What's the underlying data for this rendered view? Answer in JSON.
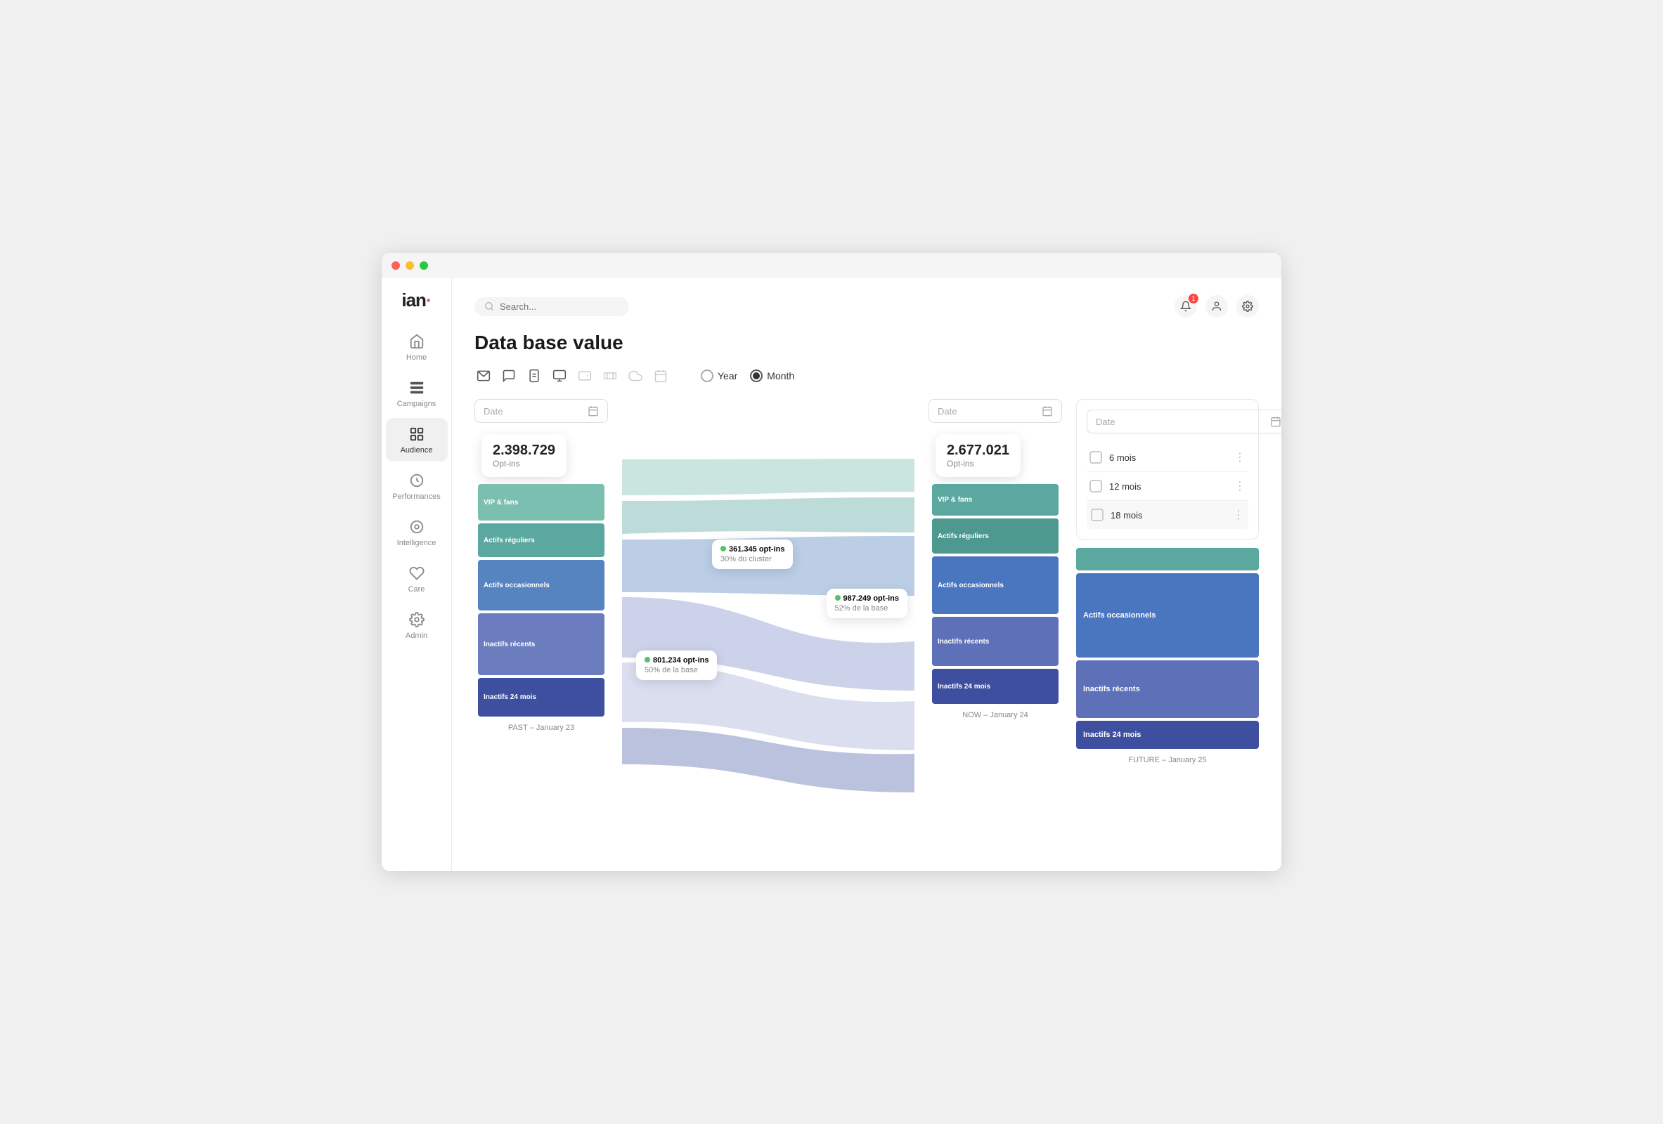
{
  "app": {
    "logo": "ian",
    "logo_dot": "·"
  },
  "topbar": {
    "search_placeholder": "Search...",
    "notification_count": "1"
  },
  "nav": {
    "items": [
      {
        "id": "home",
        "label": "Home",
        "active": false
      },
      {
        "id": "campaigns",
        "label": "Campaigns",
        "active": false
      },
      {
        "id": "audience",
        "label": "Audience",
        "active": true
      },
      {
        "id": "performances",
        "label": "Performances",
        "active": false
      },
      {
        "id": "intelligence",
        "label": "Intelligence",
        "active": false
      },
      {
        "id": "care",
        "label": "Care",
        "active": false
      },
      {
        "id": "admin",
        "label": "Admin",
        "active": false
      }
    ]
  },
  "page": {
    "title": "Data base value"
  },
  "toolbar": {
    "period_options": [
      {
        "id": "year",
        "label": "Year",
        "selected": false
      },
      {
        "id": "month",
        "label": "Month",
        "selected": true
      }
    ]
  },
  "columns": {
    "past": {
      "date_placeholder": "Date",
      "label": "PAST – January 23",
      "optins_num": "2.398.729",
      "optins_label": "Opt-ins",
      "segments": [
        {
          "label": "VIP & fans",
          "color": "#7bbfb0",
          "height": 60
        },
        {
          "label": "Actifs réguliers",
          "color": "#5ba8a0",
          "height": 55
        },
        {
          "label": "Actifs occasionnels",
          "color": "#5584c0",
          "height": 80
        },
        {
          "label": "Inactifs récents",
          "color": "#6b7dbf",
          "height": 100
        },
        {
          "label": "Inactifs 24 mois",
          "color": "#3d4f9e",
          "height": 60
        }
      ]
    },
    "now": {
      "date_placeholder": "Date",
      "label": "NOW – January 24",
      "optins_num": "2.677.021",
      "optins_label": "Opt-ins",
      "segments": [
        {
          "label": "VIP & fans",
          "color": "#5ba8a0",
          "height": 50
        },
        {
          "label": "Actifs réguliers",
          "color": "#4d9990",
          "height": 55
        },
        {
          "label": "Actifs occasionnels",
          "color": "#4a76c0",
          "height": 90
        },
        {
          "label": "Inactifs récents",
          "color": "#5e70b8",
          "height": 75
        },
        {
          "label": "Inactifs 24 mois",
          "color": "#3d4f9e",
          "height": 55
        }
      ]
    },
    "future": {
      "date_placeholder": "Date",
      "label": "FUTURE – January 25",
      "segments": [
        {
          "label": "Actifs occasionnels",
          "color": "#4a76c0",
          "height": 130
        },
        {
          "label": "Inactifs récents",
          "color": "#5e70b8",
          "height": 90
        },
        {
          "label": "Inactifs 24 mois",
          "color": "#3d4f9e",
          "height": 45
        }
      ],
      "top_seg": {
        "label": "",
        "color": "#5ba8a0",
        "height": 35
      },
      "checkbox_options": [
        {
          "id": "6mois",
          "label": "6 mois",
          "checked": false
        },
        {
          "id": "12mois",
          "label": "12 mois",
          "checked": false
        },
        {
          "id": "18mois",
          "label": "18 mois",
          "checked": false,
          "highlighted": true
        }
      ]
    }
  },
  "tooltips": [
    {
      "id": "t1",
      "value": "801.234 opt-ins",
      "sub": "50% de la base"
    },
    {
      "id": "t2",
      "value": "361.345 opt-ins",
      "sub": "30% du cluster"
    },
    {
      "id": "t3",
      "value": "987.249 opt-ins",
      "sub": "52% de la base"
    }
  ]
}
